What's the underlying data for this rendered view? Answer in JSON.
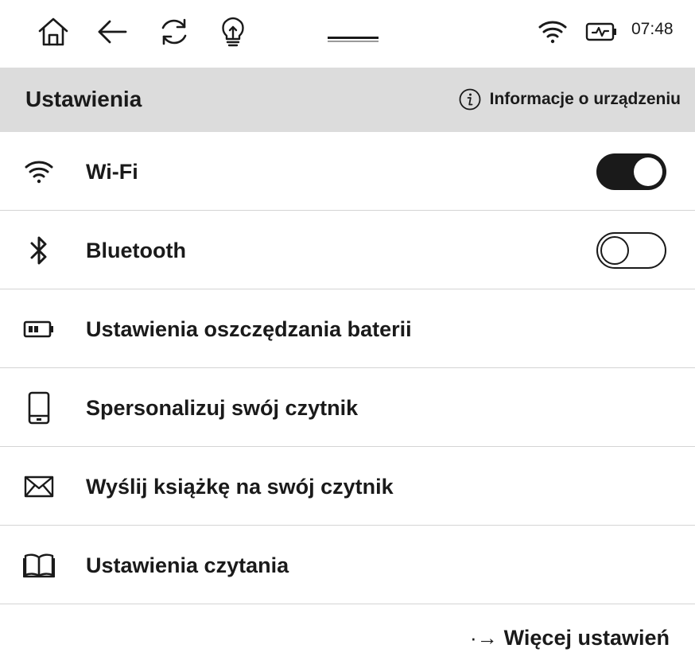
{
  "status_bar": {
    "icons": [
      "home-icon",
      "back-arrow-icon",
      "refresh-icon",
      "frontlight-bulb-icon",
      "wifi-icon",
      "battery-charging-icon"
    ],
    "time": "07:48"
  },
  "header": {
    "title": "Ustawienia",
    "device_info_label": "Informacje o urządzeniu",
    "device_info_icon": "info-icon"
  },
  "settings": {
    "items": [
      {
        "label": "Wi-Fi",
        "icon": "wifi-icon",
        "toggle": "on"
      },
      {
        "label": "Bluetooth",
        "icon": "bluetooth-icon",
        "toggle": "off"
      },
      {
        "label": "Ustawienia oszczędzania baterii",
        "icon": "battery-icon"
      },
      {
        "label": "Spersonalizuj swój czytnik",
        "icon": "tablet-icon"
      },
      {
        "label": "Wyślij książkę na swój czytnik",
        "icon": "envelope-icon"
      },
      {
        "label": "Ustawienia czytania",
        "icon": "open-book-icon"
      }
    ]
  },
  "more": {
    "arrow": "·→",
    "label": "Więcej ustawień"
  },
  "colors": {
    "header_background": "#dcdcdc",
    "text": "#1a1a1a",
    "divider": "#d4d4d4"
  }
}
